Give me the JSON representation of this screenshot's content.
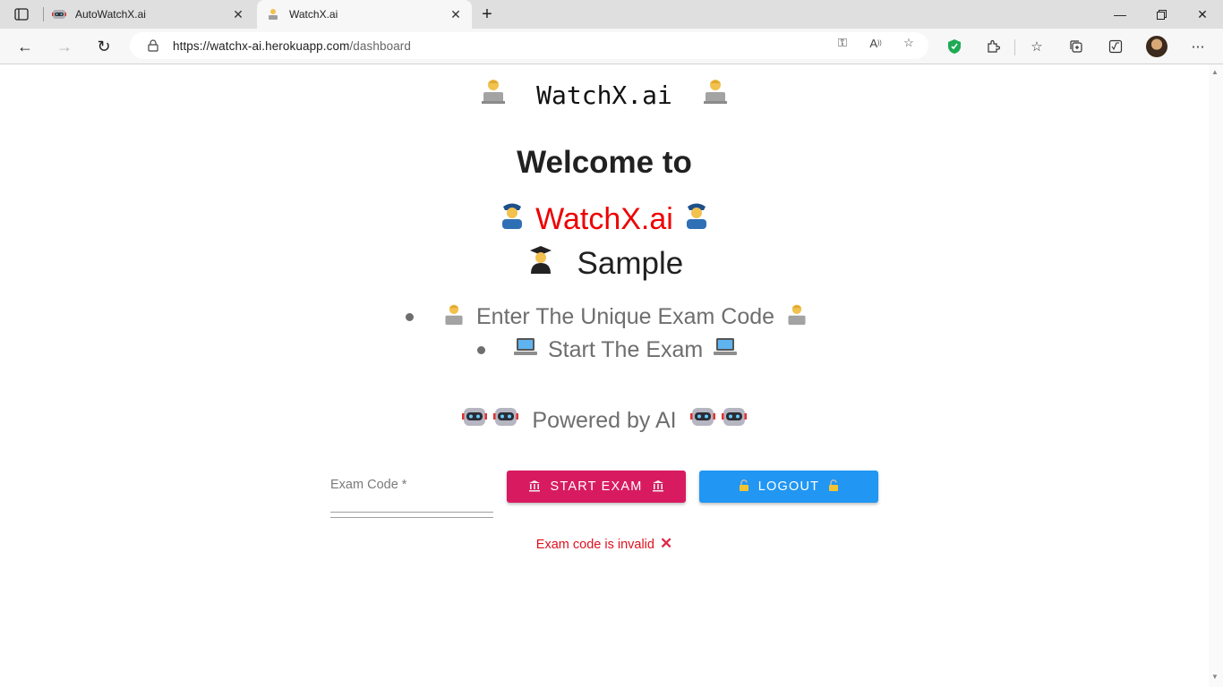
{
  "browser": {
    "tabs": [
      {
        "title": "AutoWatchX.ai",
        "favicon": "robot-icon",
        "active": false
      },
      {
        "title": "WatchX.ai",
        "favicon": "technologist-icon",
        "active": true
      }
    ],
    "url_host": "https://watchx-ai.herokuapp.com",
    "url_path": "/dashboard"
  },
  "page": {
    "brand_text": "WatchX.ai",
    "welcome_text": "Welcome to",
    "site_name": "WatchX.ai",
    "user_name": "Sample",
    "instructions": [
      {
        "text": "Enter The Unique Exam Code",
        "icon": "technologist-icon"
      },
      {
        "text": "Start The Exam",
        "icon": "laptop-icon"
      }
    ],
    "powered_by": "Powered by AI",
    "exam_code_label": "Exam Code *",
    "exam_code_value": "",
    "start_button": "START EXAM",
    "logout_button": "LOGOUT",
    "error_message": "Exam code is invalid"
  },
  "colors": {
    "brand_red": "#ee0000",
    "start_button": "#d81b60",
    "logout_button": "#2196f3",
    "error": "#e0101f"
  }
}
